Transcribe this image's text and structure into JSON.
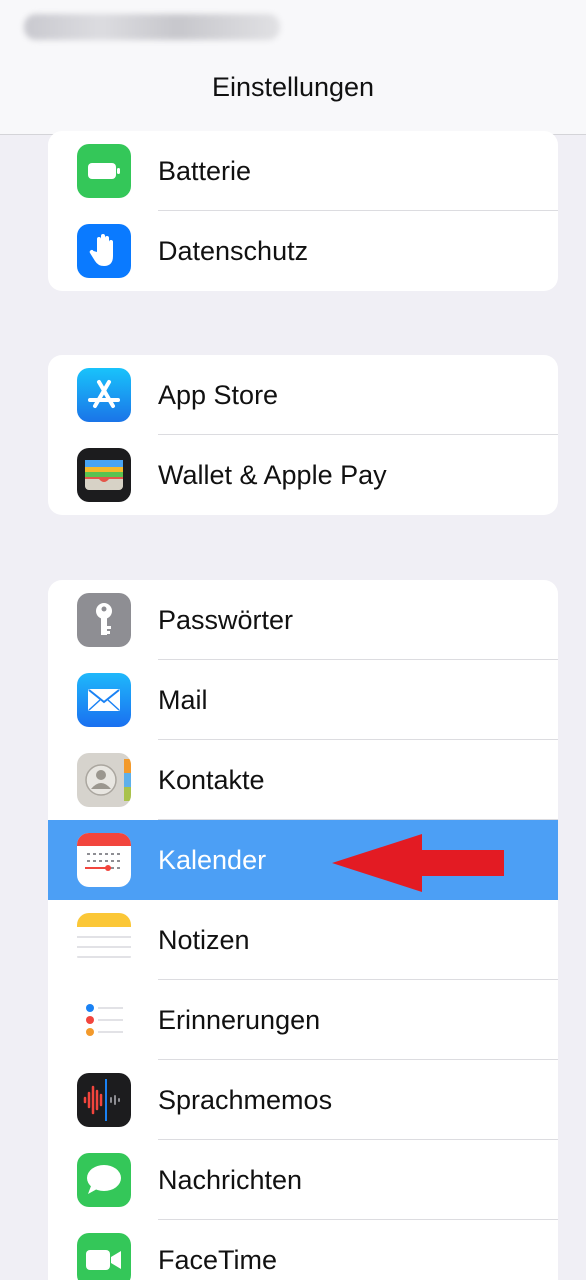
{
  "nav": {
    "title": "Einstellungen"
  },
  "sections": [
    {
      "items": [
        {
          "label": "Batterie",
          "icon": "battery-icon",
          "color": "#34c759"
        },
        {
          "label": "Datenschutz",
          "icon": "hand-icon",
          "color": "#0a7aff"
        }
      ]
    },
    {
      "items": [
        {
          "label": "App Store",
          "icon": "app-store-icon",
          "color": "#1c8ef9"
        },
        {
          "label": "Wallet & Apple Pay",
          "icon": "wallet-icon",
          "color": "#1c1c1e"
        }
      ]
    },
    {
      "items": [
        {
          "label": "Passwörter",
          "icon": "key-icon",
          "color": "#8e8e93"
        },
        {
          "label": "Mail",
          "icon": "mail-icon",
          "color": "#1a8cff"
        },
        {
          "label": "Kontakte",
          "icon": "contacts-icon",
          "color": "#d6d3cd"
        },
        {
          "label": "Kalender",
          "icon": "calendar-icon",
          "color": "#ffffff",
          "highlighted": true
        },
        {
          "label": "Notizen",
          "icon": "notes-icon",
          "color": "#ffffff"
        },
        {
          "label": "Erinnerungen",
          "icon": "reminders-icon",
          "color": "#ffffff"
        },
        {
          "label": "Sprachmemos",
          "icon": "voice-memos-icon",
          "color": "#1c1c1e"
        },
        {
          "label": "Nachrichten",
          "icon": "messages-icon",
          "color": "#34c759"
        },
        {
          "label": "FaceTime",
          "icon": "facetime-icon",
          "color": "#34c759"
        }
      ]
    }
  ],
  "annotation": {
    "icon": "red-arrow-icon",
    "color": "#e31b23"
  },
  "colors": {
    "background": "#f0eff5",
    "highlight": "#4c9ff5"
  }
}
